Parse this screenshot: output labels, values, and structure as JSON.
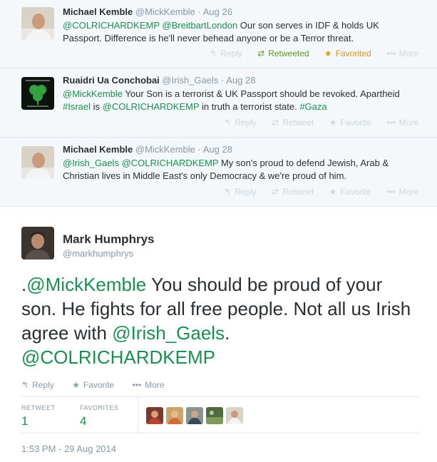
{
  "tweets": [
    {
      "name": "Michael Kemble",
      "handle": "@MickKemble",
      "dot": "·",
      "time": "Aug 26",
      "mention1": "@COLRICHARDKEMP",
      "space": " ",
      "mention2": "@BreitbartLondon",
      "text": " Our son serves in IDF & holds UK Passport.  Difference is he'll never behead anyone or be a Terror threat.",
      "reply": "Reply",
      "retweet": "Retweeted",
      "favorite": "Favorited",
      "more": "More"
    },
    {
      "name": "Ruaidri Ua Conchobai",
      "handle": "@Irish_Gaels",
      "dot": "·",
      "time": "Aug 28",
      "mention1": "@MickKemble",
      "text1": " Your Son is a terrorist & UK Passport should be revoked. Apartheid ",
      "hashtag1": "#Israel",
      "text2": " is ",
      "mention2": "@COLRICHARDKEMP",
      "text3": " in truth a terrorist state. ",
      "hashtag2": "#Gaza",
      "reply": "Reply",
      "retweet": "Retweet",
      "favorite": "Favorite",
      "more": "More"
    },
    {
      "name": "Michael Kemble",
      "handle": "@MickKemble",
      "dot": "·",
      "time": "Aug 28",
      "mention1": "@Irish_Gaels",
      "space": " ",
      "mention2": "@COLRICHARDKEMP",
      "text": " My son's proud to defend Jewish, Arab & Christian lives in Middle East's only Democracy & we're proud of him.",
      "reply": "Reply",
      "retweet": "Retweet",
      "favorite": "Favorite",
      "more": "More"
    }
  ],
  "main": {
    "name": "Mark Humphrys",
    "handle": "@markhumphrys",
    "prefix": ".",
    "mention1": "@MickKemble",
    "text1": "  You should be proud of your son. He fights for all free people. Not all us Irish agree with ",
    "mention2": "@Irish_Gaels",
    "text2": ". ",
    "mention3": "@COLRICHARDKEMP",
    "reply": "Reply",
    "favorite": "Favorite",
    "more": "More",
    "retweet_label": "RETWEET",
    "retweet_count": "1",
    "favorites_label": "FAVORITES",
    "favorites_count": "4",
    "timestamp": "1:53 PM - 29 Aug 2014"
  },
  "icons": {
    "reply": "reply-icon",
    "retweet": "retweet-icon",
    "favorite": "star-icon",
    "more": "more-dots-icon"
  },
  "colors": {
    "link": "#1a8f51",
    "retweeted": "#609928",
    "favorited": "#e0941d",
    "muted": "#8899a6",
    "reply_background": "#f5f8fa"
  }
}
